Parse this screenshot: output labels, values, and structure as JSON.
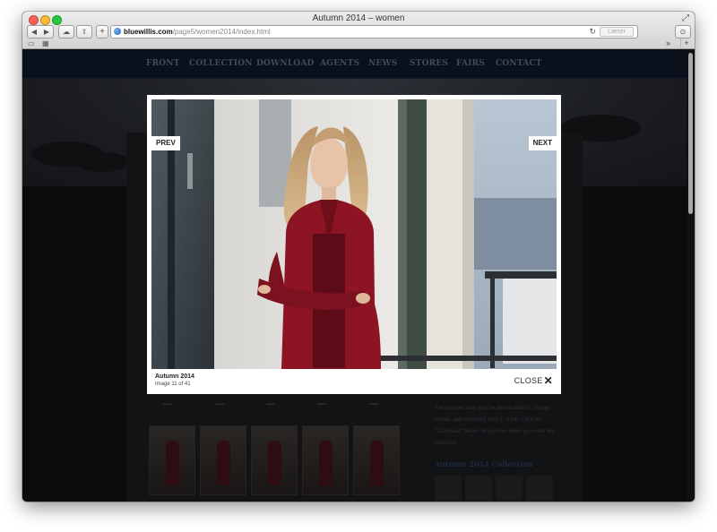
{
  "window": {
    "title": "Autumn 2014 – women",
    "url_domain": "bluewillis.com",
    "url_path": "/page5/women2014/index.html",
    "reader_label": "Læser"
  },
  "site_nav": {
    "items": [
      "FRONT",
      "COLLECTION",
      "DOWNLOAD",
      "AGENTS",
      "NEWS",
      "STORES",
      "FAIRS",
      "CONTACT"
    ]
  },
  "lightbox": {
    "prev_label": "PREV",
    "next_label": "NEXT",
    "caption_title": "Autumn 2014",
    "caption_count": "Image 11 of 41",
    "close_label": "CLOSE"
  },
  "background_page": {
    "side_text": "The pictures may also be downloaded in a larger format, approximately from 1–3 MB. Click on \"Download\" below the pictures when you enter the collection.",
    "side_heading": "Autumn 2014 Collection"
  },
  "icons": {
    "close": "close-x-icon",
    "globe": "globe-icon",
    "reload": "reload-icon"
  },
  "colors": {
    "overlay_bg": "#0c0c0e",
    "nav_bg": "#0b111c",
    "jacket_red": "#8d1423"
  }
}
